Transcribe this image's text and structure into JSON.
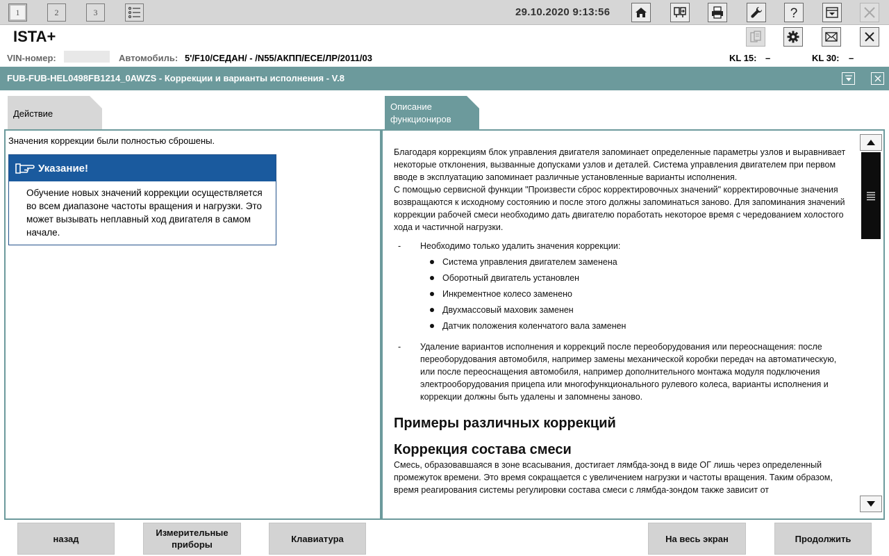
{
  "topbar": {
    "tabs": [
      "1",
      "2",
      "3"
    ],
    "datetime": "29.10.2020 9:13:56",
    "icons": [
      "home-icon",
      "connection-icon",
      "print-icon",
      "wrench-icon",
      "help-icon",
      "minimize-icon",
      "close-icon"
    ]
  },
  "app": {
    "title": "ISTA+",
    "icons": [
      "clipboard-icon",
      "gear-icon",
      "mail-icon",
      "close-icon"
    ]
  },
  "vehicle": {
    "vin_label": "VIN-номер:",
    "car_label": "Автомобиль:",
    "car_value": "5'/F10/СЕДАН/ - /N55/АКПП/ЕСЕ/ЛР/2011/03",
    "kl15_label": "KL 15:",
    "kl15_value": "–",
    "kl30_label": "KL 30:",
    "kl30_value": "–"
  },
  "function": {
    "title": "FUB-FUB-HEL0498FB1214_0AWZS - Коррекции и варианты исполнения - V.8"
  },
  "left_panel": {
    "tab_label": "Действие",
    "message": "Значения коррекции были полностью сброшены.",
    "hint": {
      "title": "Указание!",
      "body": "Обучение новых значений коррекции осуществляется во всем диапазоне частоты вращения и нагрузки. Это может вызывать неплавный ход двигателя в самом начале."
    }
  },
  "right_panel": {
    "tab_label_line1": "Описание",
    "tab_label_line2": "функциониров",
    "para1": "Благодаря коррекциям блок управления двигателя запоминает определенные параметры узлов и выравнивает некоторые отклонения, вызванные допусками узлов и деталей. Система управления двигателем при первом вводе в эксплуатацию запоминает различные установленные варианты исполнения.",
    "para2": "С помощью сервисной функции \"Произвести сброс корректировочных значений\" корректировочные значения возвращаются к исходному состоянию и после этого должны запоминаться заново. Для запоминания значений коррекции рабочей смеси необходимо дать двигателю поработать некоторое время с чередованием холостого хода и частичной нагрузки.",
    "dash_symbol": "-",
    "item1": "Необходимо только удалить значения коррекции:",
    "bullets": [
      "Система управления двигателем заменена",
      "Оборотный двигатель установлен",
      "Инкрементное колесо заменено",
      "Двухмассовый маховик заменен",
      "Датчик положения коленчатого вала заменен"
    ],
    "item2": "Удаление вариантов исполнения и коррекций после переоборудования или переоснащения: после переоборудования автомобиля, например замены механической коробки передач на автоматическую, или после переоснащения автомобиля, например дополнительного монтажа модуля подключения электрооборудования прицепа или многофункционального рулевого колеса, варианты исполнения и коррекции должны быть удалены и запомнены заново.",
    "heading1": "Примеры различных коррекций",
    "heading2": "Коррекция состава смеси",
    "para3": "Смесь, образовавшаяся в зоне всасывания, достигает лямбда-зонд в виде ОГ лишь через определенный промежуток времени. Это время сокращается с увеличением нагрузки и частоты вращения. Таким образом, время реагирования системы регулировки состава смеси с лямбда-зондом также зависит от"
  },
  "buttons": {
    "back": "назад",
    "instruments_line1": "Измерительные",
    "instruments_line2": "приборы",
    "keyboard": "Клавиатура",
    "fullscreen": "На весь экран",
    "continue": "Продолжить"
  },
  "colors": {
    "teal": "#6c9a9c",
    "hint_blue": "#1a5a9e",
    "button_gray": "#d3d3d3"
  }
}
